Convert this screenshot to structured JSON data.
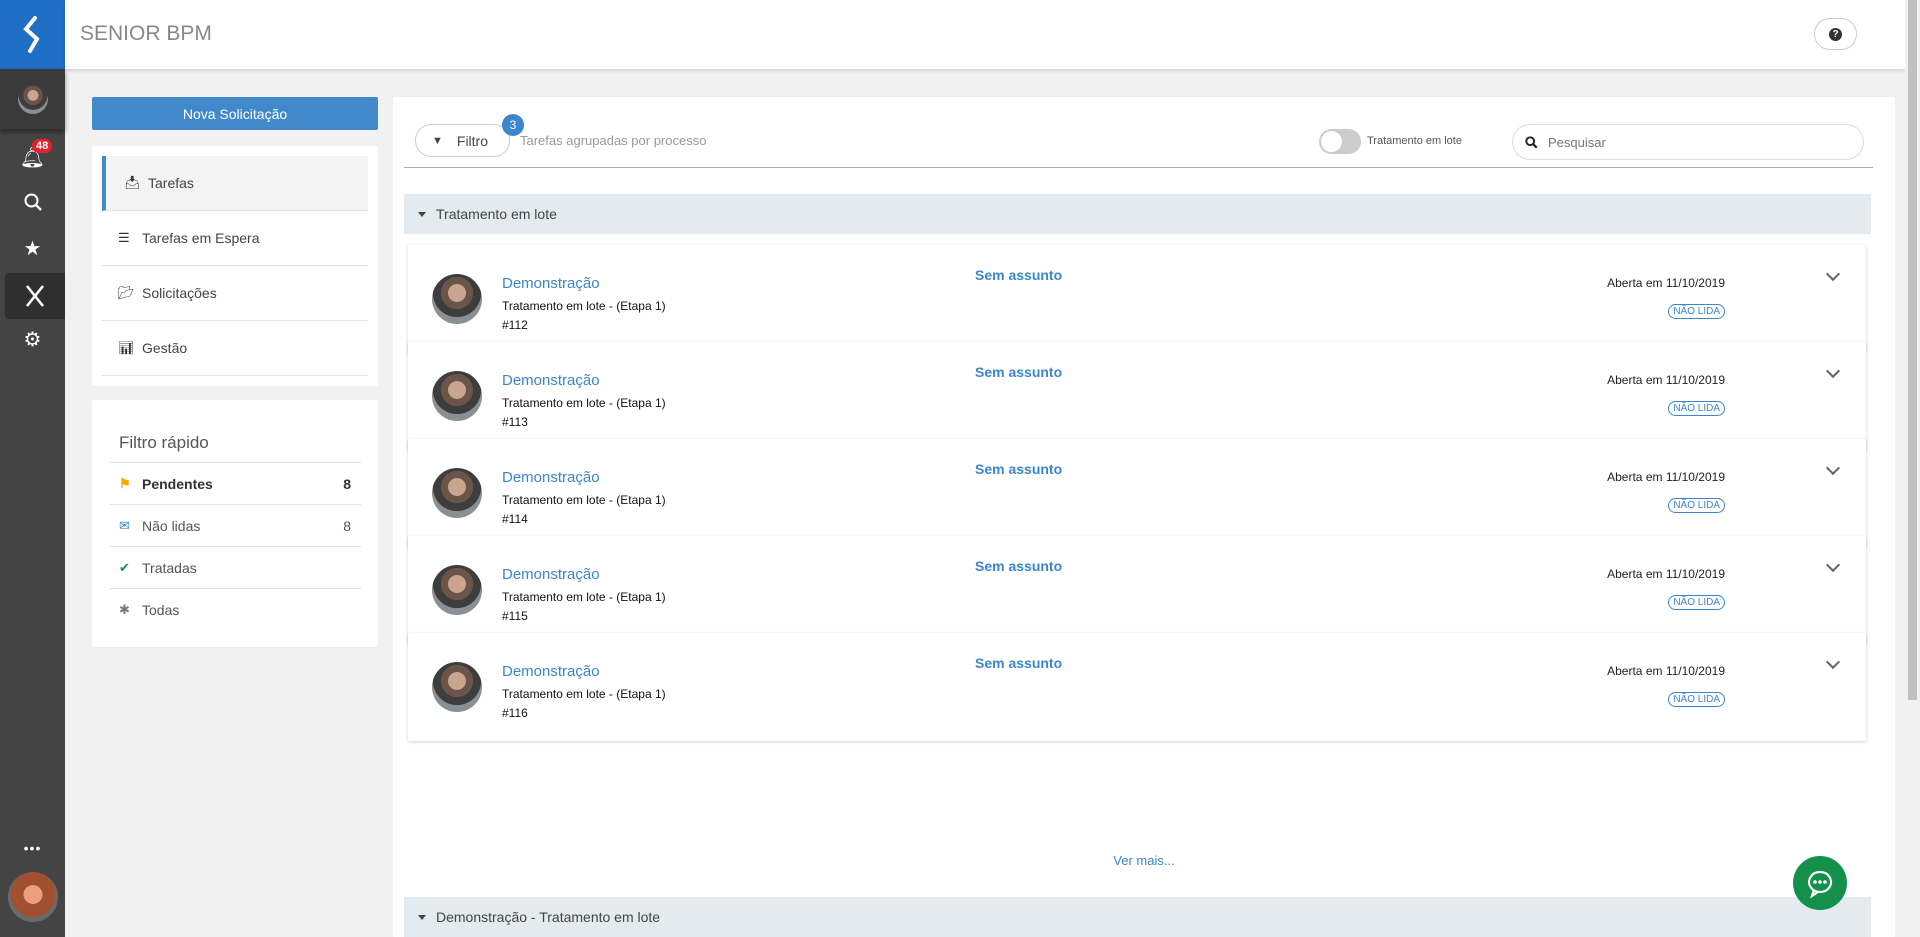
{
  "header": {
    "title": "SENIOR BPM",
    "help_icon": "?"
  },
  "rail": {
    "notification_count": "48"
  },
  "sidebar": {
    "new_request": "Nova Solicitação",
    "nav": [
      {
        "label": "Tarefas"
      },
      {
        "label": "Tarefas em Espera"
      },
      {
        "label": "Solicitações"
      },
      {
        "label": "Gestão"
      }
    ],
    "quick_filter": {
      "title": "Filtro rápido",
      "items": [
        {
          "label": "Pendentes",
          "count": "8"
        },
        {
          "label": "Não lidas",
          "count": "8"
        },
        {
          "label": "Tratadas"
        },
        {
          "label": "Todas"
        }
      ]
    }
  },
  "toolbar": {
    "filter_label": "Filtro",
    "filter_count": "3",
    "grouping": "Tarefas agrupadas por processo",
    "batch_label": "Tratamento em lote",
    "batch_enabled": false,
    "search_placeholder": "Pesquisar"
  },
  "groups": [
    {
      "title": "Tratamento em lote"
    },
    {
      "title": "Demonstração - Tratamento em lote"
    }
  ],
  "tasks": [
    {
      "process": "Demonstração",
      "step": "Tratamento em lote - (Etapa 1)",
      "number": "#112",
      "subject": "Sem assunto",
      "opened": "Aberta em 11/10/2019",
      "status": "NÃO LIDA"
    },
    {
      "process": "Demonstração",
      "step": "Tratamento em lote - (Etapa 1)",
      "number": "#113",
      "subject": "Sem assunto",
      "opened": "Aberta em 11/10/2019",
      "status": "NÃO LIDA"
    },
    {
      "process": "Demonstração",
      "step": "Tratamento em lote - (Etapa 1)",
      "number": "#114",
      "subject": "Sem assunto",
      "opened": "Aberta em 11/10/2019",
      "status": "NÃO LIDA"
    },
    {
      "process": "Demonstração",
      "step": "Tratamento em lote - (Etapa 1)",
      "number": "#115",
      "subject": "Sem assunto",
      "opened": "Aberta em 11/10/2019",
      "status": "NÃO LIDA"
    },
    {
      "process": "Demonstração",
      "step": "Tratamento em lote - (Etapa 1)",
      "number": "#116",
      "subject": "Sem assunto",
      "opened": "Aberta em 11/10/2019",
      "status": "NÃO LIDA"
    }
  ],
  "see_more": "Ver mais...",
  "colors": {
    "accent": "#3b86cc",
    "brand": "#1e6fc5",
    "rail": "#444444",
    "chat": "#13914a",
    "badge": "#e8202a"
  }
}
